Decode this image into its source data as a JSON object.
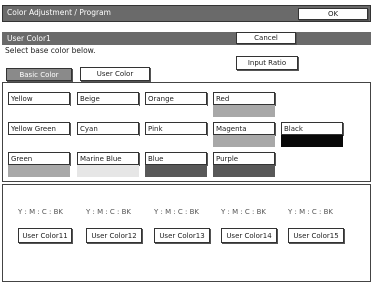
{
  "header": {
    "title": "Color Adjustment / Program",
    "ok_label": "OK"
  },
  "subheader": {
    "title": "User Color1",
    "cancel_label": "Cancel"
  },
  "instruction": "Select base color below.",
  "tabs": {
    "basic_label": "Basic Color",
    "user_label": "User Color"
  },
  "input_ratio_label": "Input Ratio",
  "colors": {
    "yellow": "Yellow",
    "beige": "Beige",
    "orange": "Orange",
    "red": "Red",
    "yellow_green": "Yellow Green",
    "cyan": "Cyan",
    "pink": "Pink",
    "magenta": "Magenta",
    "black": "Black",
    "green": "Green",
    "marine_blue": "Marine Blue",
    "blue": "Blue",
    "purple": "Purple"
  },
  "user_colors": [
    {
      "ratio": "Y : M : C : BK",
      "label": "User Color11"
    },
    {
      "ratio": "Y : M : C : BK",
      "label": "User Color12"
    },
    {
      "ratio": "Y : M : C : BK",
      "label": "User Color13"
    },
    {
      "ratio": "Y : M : C : BK",
      "label": "User Color14"
    },
    {
      "ratio": "Y : M : C : BK",
      "label": "User Color15"
    }
  ]
}
